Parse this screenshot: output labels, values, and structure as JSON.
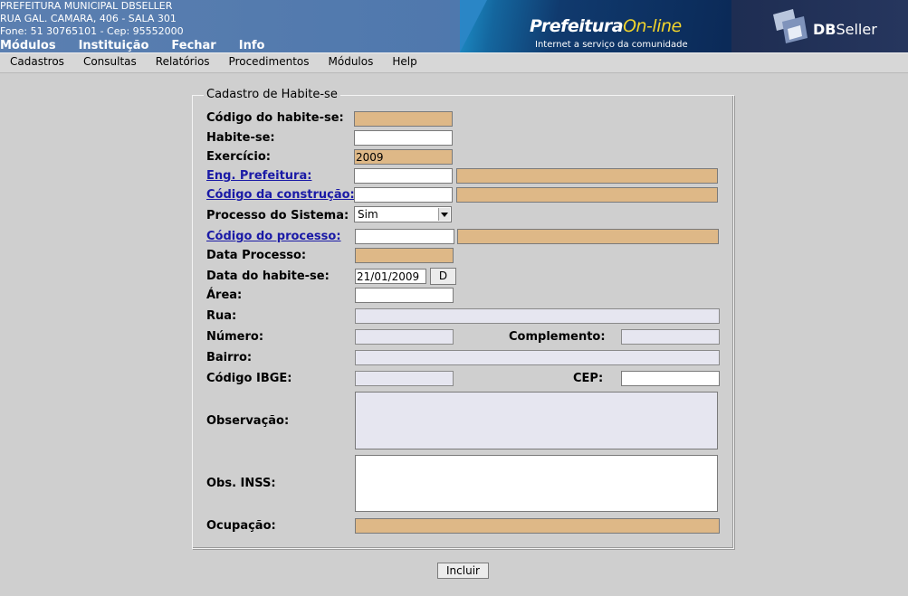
{
  "header": {
    "address_lines": [
      "PREFEITURA MUNICIPAL DBSELLER",
      "RUA GAL. CAMARA, 406 - SALA 301",
      "Fone: 51 30765101  -  Cep: 95552000"
    ],
    "top_nav": [
      "Módulos",
      "Instituição",
      "Fechar",
      "Info"
    ],
    "logo_prefeitura": "Prefeitura",
    "logo_online": "On-line",
    "logo_tagline": "Internet a serviço da comunidade",
    "logo_db_bold": "DB",
    "logo_db_rest": "Seller"
  },
  "menubar": [
    "Cadastros",
    "Consultas",
    "Relatórios",
    "Procedimentos",
    "Módulos",
    "Help"
  ],
  "form": {
    "legend": "Cadastro de Habite-se",
    "labels": {
      "codigo_habite": "Código do habite-se:",
      "habite": "Habite-se:",
      "exercicio": "Exercício:",
      "eng_prefeitura": "Eng. Prefeitura:",
      "codigo_construcao": "Código da construção:",
      "processo_sistema": "Processo do Sistema:",
      "codigo_processo": "Código do processo:",
      "data_processo": "Data Processo:",
      "data_habite": "Data do habite-se:",
      "area": "Área:",
      "rua": "Rua:",
      "numero": "Número:",
      "complemento": "Complemento:",
      "bairro": "Bairro:",
      "codigo_ibge": "Código IBGE:",
      "cep": "CEP:",
      "observacao": "Observação:",
      "obs_inss": "Obs. INSS:",
      "ocupacao": "Ocupação:"
    },
    "values": {
      "exercicio": "2009",
      "processo_sistema": "Sim",
      "data_habite": "21/01/2009"
    },
    "date_button": "D",
    "submit": "Incluir"
  }
}
